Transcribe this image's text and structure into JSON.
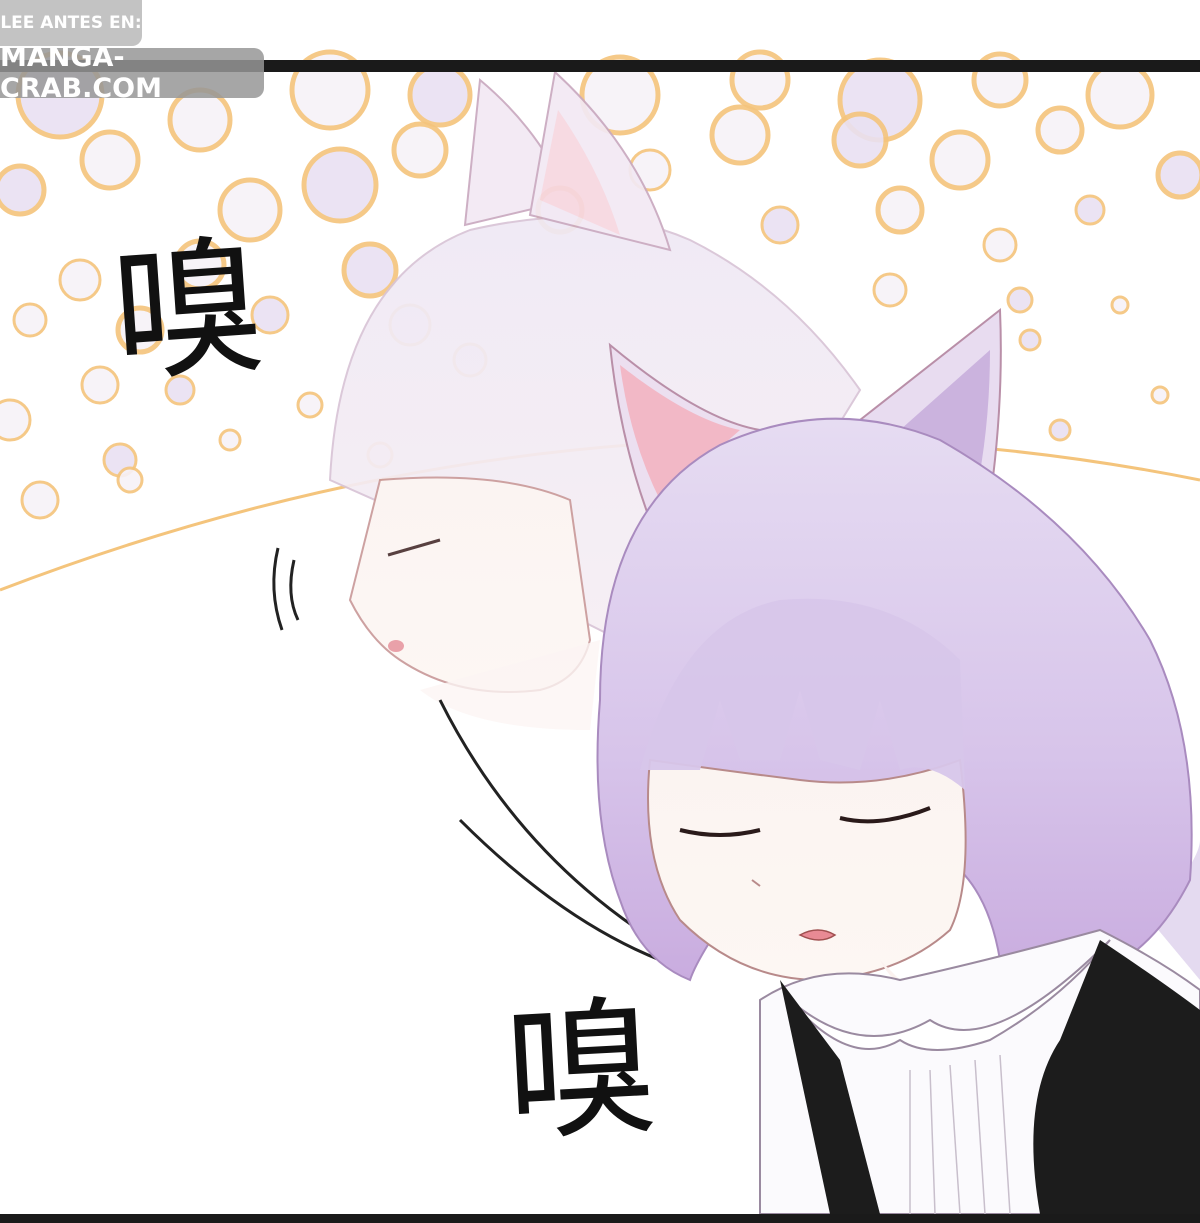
{
  "watermark": {
    "label": "LEE ANTES EN:",
    "site": "MANGA-CRAB.COM"
  },
  "sound_effects": {
    "sfx_top": "嗅",
    "sfx_bottom": "嗅"
  },
  "colors": {
    "bubble_ring": "#f4c47c",
    "bubble_fill": "#ece6f4",
    "hair": "#d9c8ec",
    "ear_inner": "#f2b8c6",
    "vest": "#1c1c1c",
    "blouse": "#fbfafd",
    "motion_line": "#222222"
  }
}
